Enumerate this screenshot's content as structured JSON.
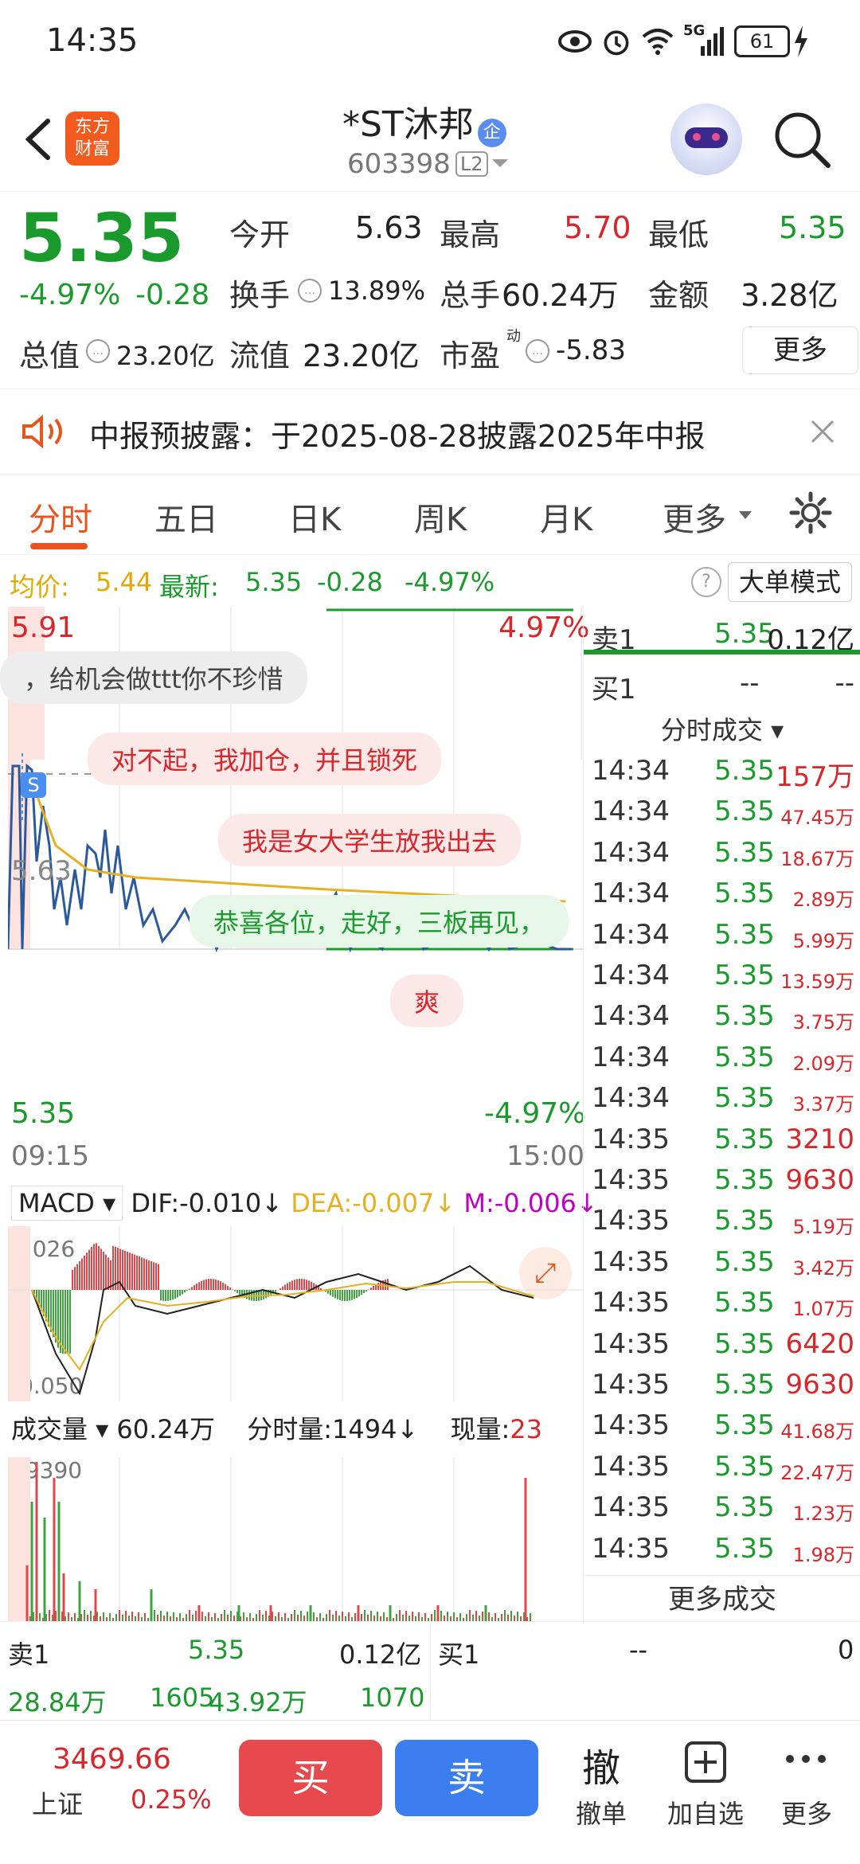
{
  "status": {
    "time": "14:35",
    "battery": "61",
    "network": "5G"
  },
  "header": {
    "title": "*ST沐邦",
    "title_badge": "企",
    "code": "603398",
    "level": "L2",
    "logo_line1": "东方",
    "logo_line2": "财富"
  },
  "quote": {
    "price": "5.35",
    "change_pct": "-4.97%",
    "change_abs": "-0.28",
    "open_label": "今开",
    "open": "5.63",
    "high_label": "最高",
    "high": "5.70",
    "low_label": "最低",
    "low": "5.35",
    "turnover_label": "换手",
    "turnover": "13.89%",
    "volume_label": "总手",
    "volume": "60.24万",
    "amount_label": "金额",
    "amount": "3.28亿",
    "mktcap_label": "总值",
    "mktcap": "23.20亿",
    "float_label": "流值",
    "float": "23.20亿",
    "pe_label": "市盈",
    "pe_sup": "动",
    "pe": "-5.83",
    "more_label": "更多"
  },
  "notice": {
    "text": "中报预披露：于2025-08-28披露2025年中报"
  },
  "tabs": [
    "分时",
    "五日",
    "日K",
    "周K",
    "月K",
    "更多"
  ],
  "info": {
    "avg_label": "均价:",
    "avg": "5.44",
    "latest_label": "最新:",
    "latest": "5.35",
    "latest_chg": "-0.28",
    "latest_pct": "-4.97%",
    "mode_btn": "大单模式"
  },
  "chart": {
    "y_max": "5.91",
    "y_min": "5.35",
    "y_ref": "5.63",
    "pct_max": "4.97%",
    "pct_min": "-4.97%",
    "x_start": "09:15",
    "x_end": "15:00",
    "marker": "S",
    "bubbles": [
      "，给机会做ttt你不珍惜",
      "对不起，我加仓，并且锁死",
      "我是女大学生放我出去",
      "恭喜各位，走好，三板再见，",
      "爽"
    ],
    "macd_label": "MACD",
    "dif": "DIF:-0.010",
    "dea": "DEA:-0.007",
    "m": "M:-0.006",
    "macd_max": "0.026",
    "macd_min": "-0.050",
    "vol_label": "成交量",
    "vol_total": "60.24万",
    "vol_min_label": "分时量:",
    "vol_min": "1494",
    "vol_now_label": "现量:",
    "vol_now": "23",
    "vol_max": "49390"
  },
  "chart_data": {
    "type": "line",
    "x_range": [
      "09:15",
      "15:00"
    ],
    "ylim": [
      5.35,
      5.91
    ],
    "series": [
      {
        "name": "价格",
        "color": "#2a5a9c"
      },
      {
        "name": "均价",
        "color": "#e6b020"
      }
    ]
  },
  "orderbook": {
    "sell1_label": "卖1",
    "sell1_price": "5.35",
    "sell1_vol": "0.12亿",
    "buy1_label": "买1",
    "buy1_price": "--",
    "buy1_vol": "--",
    "ticks_label": "分时成交",
    "more_ticks": "更多成交"
  },
  "ticks": [
    {
      "t": "14:34",
      "p": "5.35",
      "v": "157万",
      "big": true
    },
    {
      "t": "14:34",
      "p": "5.35",
      "v": "47.45万",
      "big": false
    },
    {
      "t": "14:34",
      "p": "5.35",
      "v": "18.67万",
      "big": false
    },
    {
      "t": "14:34",
      "p": "5.35",
      "v": "2.89万",
      "big": false
    },
    {
      "t": "14:34",
      "p": "5.35",
      "v": "5.99万",
      "big": false
    },
    {
      "t": "14:34",
      "p": "5.35",
      "v": "13.59万",
      "big": false
    },
    {
      "t": "14:34",
      "p": "5.35",
      "v": "3.75万",
      "big": false
    },
    {
      "t": "14:34",
      "p": "5.35",
      "v": "2.09万",
      "big": false
    },
    {
      "t": "14:34",
      "p": "5.35",
      "v": "3.37万",
      "big": false
    },
    {
      "t": "14:35",
      "p": "5.35",
      "v": "3210",
      "big": true
    },
    {
      "t": "14:35",
      "p": "5.35",
      "v": "9630",
      "big": true
    },
    {
      "t": "14:35",
      "p": "5.35",
      "v": "5.19万",
      "big": false
    },
    {
      "t": "14:35",
      "p": "5.35",
      "v": "3.42万",
      "big": false
    },
    {
      "t": "14:35",
      "p": "5.35",
      "v": "1.07万",
      "big": false
    },
    {
      "t": "14:35",
      "p": "5.35",
      "v": "6420",
      "big": true
    },
    {
      "t": "14:35",
      "p": "5.35",
      "v": "9630",
      "big": true
    },
    {
      "t": "14:35",
      "p": "5.35",
      "v": "41.68万",
      "big": false
    },
    {
      "t": "14:35",
      "p": "5.35",
      "v": "22.47万",
      "big": false
    },
    {
      "t": "14:35",
      "p": "5.35",
      "v": "1.23万",
      "big": false
    },
    {
      "t": "14:35",
      "p": "5.35",
      "v": "1.98万",
      "big": false
    }
  ],
  "summary": {
    "sell1_label": "卖1",
    "sell1_price": "5.35",
    "sell1_vol": "0.12亿",
    "buy1_label": "买1",
    "buy1_price": "--",
    "buy1_vol": "0",
    "v1": "28.84万",
    "v2": "1605",
    "v3": "43.92万",
    "v4": "1070"
  },
  "bottom": {
    "index_value": "3469.66",
    "index_name": "上证",
    "index_pct": "0.25%",
    "buy": "买",
    "sell": "卖",
    "cancel_icon": "撤",
    "cancel": "撤单",
    "watch": "加自选",
    "more": "更多"
  }
}
